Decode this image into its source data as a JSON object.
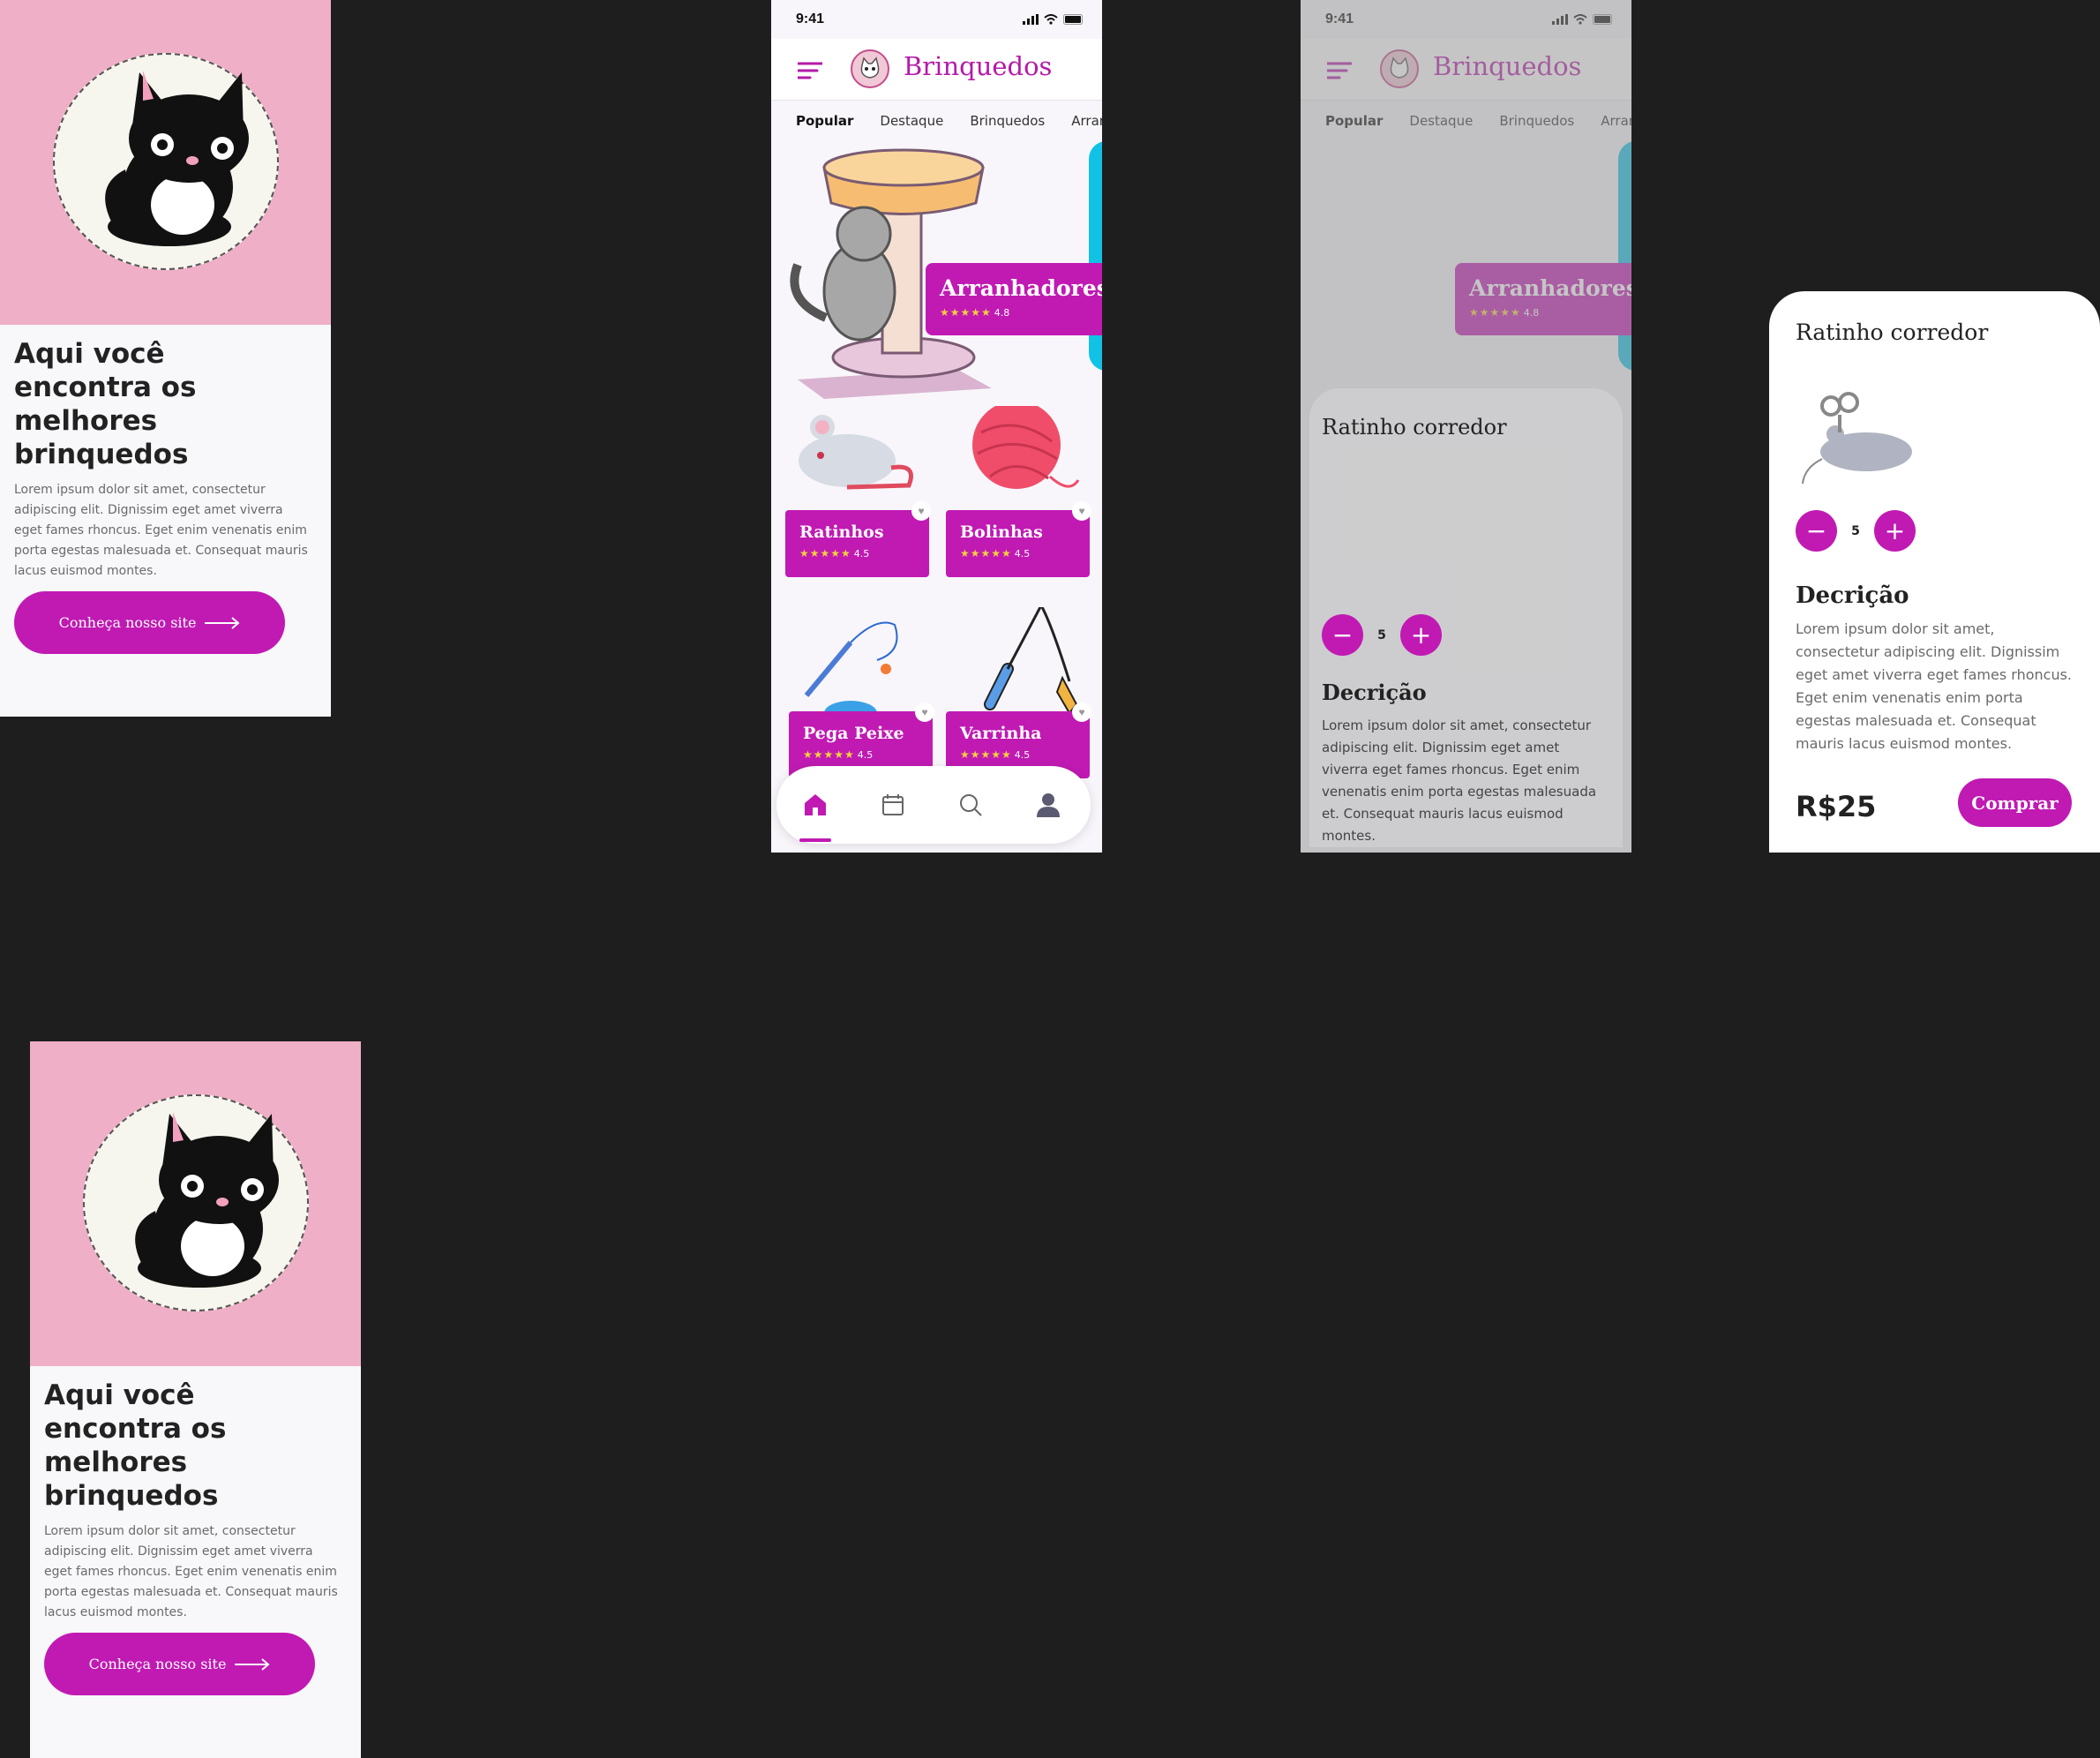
{
  "splash": {
    "heading": "Aqui você encontra os melhores brinquedos",
    "body": "Lorem ipsum dolor sit amet, consectetur adipiscing elit. Dignissim eget amet viverra eget fames rhoncus. Eget enim venenatis enim porta egestas malesuada et. Consequat mauris lacus euismod montes.",
    "cta_label": "Conheça nosso site"
  },
  "status": {
    "time": "9:41"
  },
  "app": {
    "title": "Brinquedos"
  },
  "tabs": [
    "Popular",
    "Destaque",
    "Brinquedos",
    "Arranhadores"
  ],
  "featured": {
    "name": "Arranhadores",
    "stars": "★★★★★",
    "rating": "4.8"
  },
  "products": [
    {
      "name": "Ratinhos",
      "stars": "★★★★★",
      "rating": "4.5"
    },
    {
      "name": "Bolinhas",
      "stars": "★★★★★",
      "rating": "4.5"
    },
    {
      "name": "Pega Peixe",
      "stars": "★★★★★",
      "rating": "4.5"
    },
    {
      "name": "Varrinha",
      "stars": "★★★★★",
      "rating": "4.5"
    }
  ],
  "detail": {
    "title": "Ratinho corredor",
    "quantity": "5",
    "minus": "−",
    "plus": "+",
    "description_heading": "Decrição",
    "description": "Lorem ipsum dolor sit amet, consectetur adipiscing elit. Dignissim eget amet viverra eget fames rhoncus. Eget enim venenatis enim porta egestas malesuada et. Consequat mauris lacus euismod montes.",
    "price": "R$25",
    "buy_label": "Comprar"
  },
  "colors": {
    "accent": "#c01ab3",
    "hero_pink": "#efafc6",
    "cyan": "#11c2e6",
    "background": "#1e1e1e"
  },
  "icons": [
    "menu-icon",
    "cat-logo-icon",
    "home-icon",
    "calendar-icon",
    "search-icon",
    "user-icon",
    "heart-icon",
    "arrow-right-icon"
  ]
}
